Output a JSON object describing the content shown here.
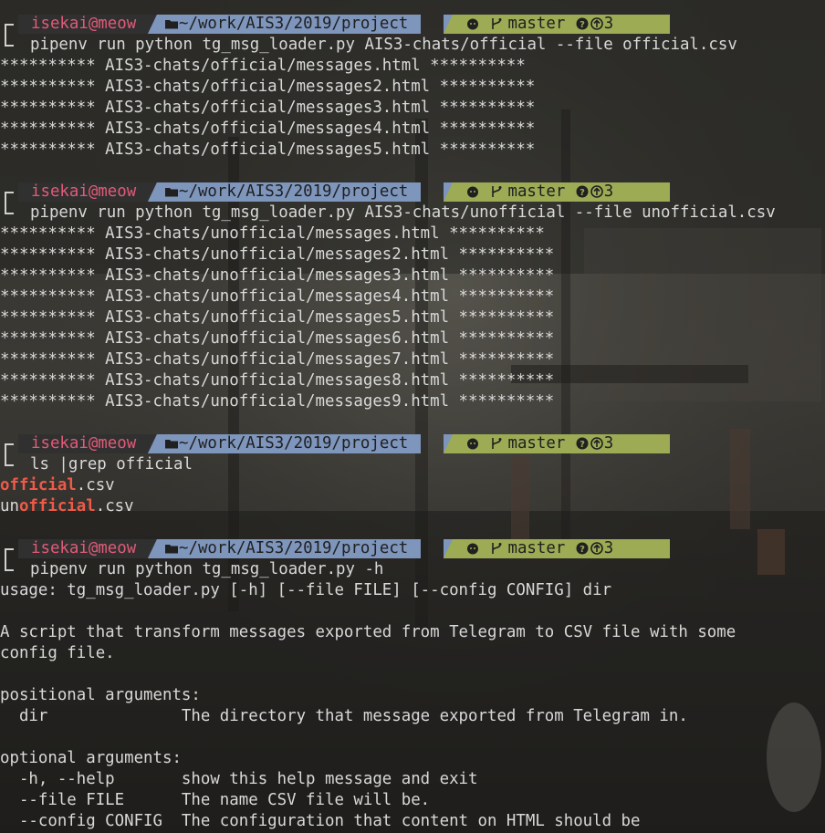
{
  "prompt": {
    "user": "isekai@meow",
    "path": "~/work/AIS3/2019/project",
    "branch": "master",
    "status": "3",
    "folder_icon": "folder-icon",
    "git_icon": "github-icon",
    "branch_icon": "branch-icon",
    "question_icon": "question-icon",
    "ahead_icon": "arrow-up-icon"
  },
  "blocks": [
    {
      "command": "pipenv run python tg_msg_loader.py AIS3-chats/official --file official.csv",
      "output": [
        "********** AIS3-chats/official/messages.html **********",
        "********** AIS3-chats/official/messages2.html **********",
        "********** AIS3-chats/official/messages3.html **********",
        "********** AIS3-chats/official/messages4.html **********",
        "********** AIS3-chats/official/messages5.html **********"
      ]
    },
    {
      "command": "pipenv run python tg_msg_loader.py AIS3-chats/unofficial --file unofficial.csv",
      "output": [
        "********** AIS3-chats/unofficial/messages.html **********",
        "********** AIS3-chats/unofficial/messages2.html **********",
        "********** AIS3-chats/unofficial/messages3.html **********",
        "********** AIS3-chats/unofficial/messages4.html **********",
        "********** AIS3-chats/unofficial/messages5.html **********",
        "********** AIS3-chats/unofficial/messages6.html **********",
        "********** AIS3-chats/unofficial/messages7.html **********",
        "********** AIS3-chats/unofficial/messages8.html **********",
        "********** AIS3-chats/unofficial/messages9.html **********"
      ]
    },
    {
      "command": "ls |grep official",
      "grep_results": [
        {
          "pre": "",
          "match": "official",
          "post": ".csv"
        },
        {
          "pre": "un",
          "match": "official",
          "post": ".csv"
        }
      ]
    },
    {
      "command": "pipenv run python tg_msg_loader.py -h",
      "output": [
        "usage: tg_msg_loader.py [-h] [--file FILE] [--config CONFIG] dir",
        "",
        "A script that transform messages exported from Telegram to CSV file with some",
        "config file.",
        "",
        "positional arguments:",
        "  dir              The directory that message exported from Telegram in.",
        "",
        "optional arguments:",
        "  -h, --help       show this help message and exit",
        "  --file FILE      The name CSV file will be.",
        "  --config CONFIG  The configuration that content on HTML should be"
      ]
    }
  ],
  "colors": {
    "user": "#e05b78",
    "path_bg": "#7e95bc",
    "git_bg": "#9dab55",
    "grep_match": "#ee5a48"
  }
}
